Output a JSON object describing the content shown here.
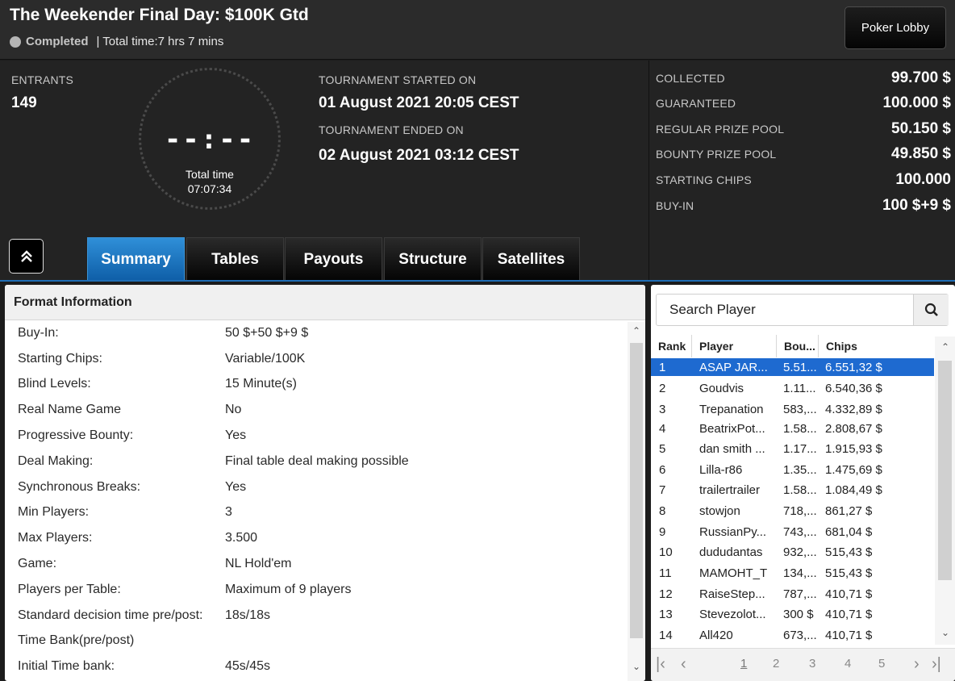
{
  "header": {
    "title": "The Weekender Final Day: $100K Gtd",
    "status": "Completed",
    "total_time": "| Total time:7 hrs  7 mins",
    "lobby_button": "Poker Lobby"
  },
  "info": {
    "entrants_label": "ENTRANTS",
    "entrants_value": "149",
    "clock_digits": "--:--",
    "clock_label": "Total time",
    "clock_time": "07:07:34",
    "started_label": "TOURNAMENT STARTED ON",
    "started_value": "01 August 2021  20:05 CEST",
    "ended_label": "TOURNAMENT ENDED ON",
    "ended_value": "02 August 2021  03:12 CEST"
  },
  "prizes": [
    {
      "label": "COLLECTED",
      "value": "99.700 $"
    },
    {
      "label": "GUARANTEED",
      "value": "100.000 $"
    },
    {
      "label": "REGULAR PRIZE POOL",
      "value": "50.150 $"
    },
    {
      "label": "BOUNTY PRIZE POOL",
      "value": "49.850 $"
    },
    {
      "label": "STARTING CHIPS",
      "value": "100.000"
    },
    {
      "label": "BUY-IN",
      "value": "100 $+9 $"
    }
  ],
  "tabs": [
    "Summary",
    "Tables",
    "Payouts",
    "Structure",
    "Satellites"
  ],
  "active_tab": "Summary",
  "format": {
    "title": "Format Information",
    "rows": [
      {
        "k": "Buy-In:",
        "v": "50 $+50 $+9 $"
      },
      {
        "k": "Starting Chips:",
        "v": "Variable/100K"
      },
      {
        "k": "Blind Levels:",
        "v": "15 Minute(s)"
      },
      {
        "k": "Real Name Game",
        "v": "No"
      },
      {
        "k": "Progressive Bounty:",
        "v": "Yes"
      },
      {
        "k": "Deal Making:",
        "v": "Final table deal making possible"
      },
      {
        "k": "Synchronous Breaks:",
        "v": "Yes"
      },
      {
        "k": "Min Players:",
        "v": "3"
      },
      {
        "k": "Max Players:",
        "v": "3.500"
      },
      {
        "k": "Game:",
        "v": "NL Hold'em"
      },
      {
        "k": "Players per Table:",
        "v": "Maximum of 9 players"
      },
      {
        "k": "Standard decision time pre/post:",
        "v": "18s/18s"
      },
      {
        "k": "Time Bank(pre/post)",
        "v": ""
      },
      {
        "k": "Initial Time bank:",
        "v": "45s/45s"
      }
    ]
  },
  "players": {
    "search_placeholder": "Search Player",
    "columns": [
      "Rank",
      "Player",
      "Bou...",
      "Chips"
    ],
    "rows": [
      {
        "rank": "1",
        "player": "ASAP JAR...",
        "bounty": "5.51...",
        "chips": "6.551,32 $"
      },
      {
        "rank": "2",
        "player": "Goudvis",
        "bounty": "1.11...",
        "chips": "6.540,36 $"
      },
      {
        "rank": "3",
        "player": "Trepanation",
        "bounty": "583,...",
        "chips": "4.332,89 $"
      },
      {
        "rank": "4",
        "player": "BeatrixPot...",
        "bounty": "1.58...",
        "chips": "2.808,67 $"
      },
      {
        "rank": "5",
        "player": "dan smith ...",
        "bounty": "1.17...",
        "chips": "1.915,93 $"
      },
      {
        "rank": "6",
        "player": "Lilla-r86",
        "bounty": "1.35...",
        "chips": "1.475,69 $"
      },
      {
        "rank": "7",
        "player": "trailertrailer",
        "bounty": "1.58...",
        "chips": "1.084,49 $"
      },
      {
        "rank": "8",
        "player": "stowjon",
        "bounty": "718,...",
        "chips": "861,27 $"
      },
      {
        "rank": "9",
        "player": "RussianPy...",
        "bounty": "743,...",
        "chips": "681,04 $"
      },
      {
        "rank": "10",
        "player": "dududantas",
        "bounty": "932,...",
        "chips": "515,43 $"
      },
      {
        "rank": "11",
        "player": "MAMOHT_T",
        "bounty": "134,...",
        "chips": "515,43 $"
      },
      {
        "rank": "12",
        "player": "RaiseStep...",
        "bounty": "787,...",
        "chips": "410,71 $"
      },
      {
        "rank": "13",
        "player": "Stevezolot...",
        "bounty": "300 $",
        "chips": "410,71 $"
      },
      {
        "rank": "14",
        "player": "All420",
        "bounty": "673,...",
        "chips": "410,71 $"
      }
    ],
    "selected_rank": "1",
    "pages": [
      "1",
      "2",
      "3",
      "4",
      "5"
    ],
    "current_page": "1"
  },
  "colors": {
    "accent_blue": "#1e6ad0",
    "active_tab": "#2f8fd8",
    "status_dot": "#b5b5b5"
  }
}
